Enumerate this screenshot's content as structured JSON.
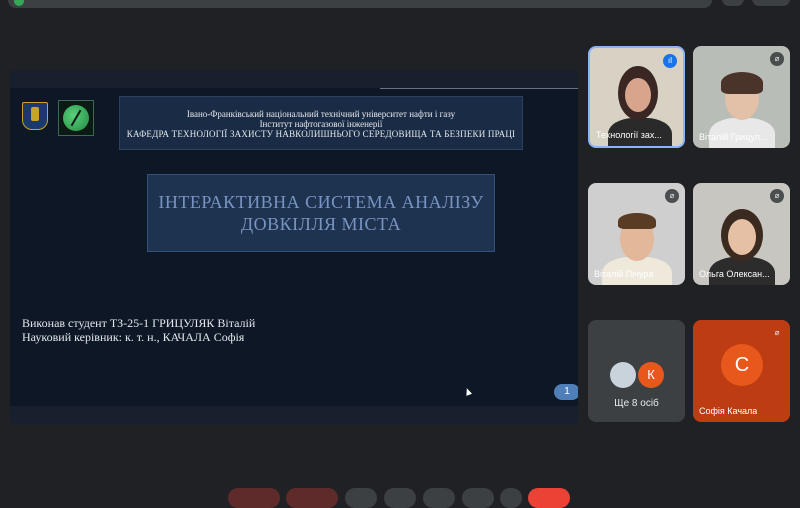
{
  "top": {
    "text": ""
  },
  "slide": {
    "header_line1": "Івано-Франківський національний технічний університет нафти і газу",
    "header_line2": "Інститут нафтогазової інженерії",
    "header_line3": "КАФЕДРА ТЕХНОЛОГІЇ ЗАХИСТУ НАВКОЛИШНЬОГО СЕРЕДОВИЩА ТА БЕЗПЕКИ ПРАЦІ",
    "title_line1": "ІНТЕРАКТИВНА СИСТЕМА АНАЛІЗУ",
    "title_line2": "ДОВКІЛЛЯ МІСТА",
    "author_line1": "Виконав студент ТЗ-25-1 ГРИЦУЛЯК Віталій",
    "author_line2": "Науковий керівник: к. т. н., КАЧАЛА Софія",
    "page_number": "1"
  },
  "participants": [
    {
      "name": "Технології зах...",
      "speaking": true
    },
    {
      "name": "Віталій Грицул...",
      "muted": true
    },
    {
      "name": "Віталій Пічура",
      "muted": true
    },
    {
      "name": "Ольга Олексан...",
      "muted": true
    }
  ],
  "more": {
    "label": "Ще 8 осіб",
    "avatar_letter": "К"
  },
  "sofia": {
    "name": "Софія Качала",
    "avatar_letter": "С"
  },
  "bottom": {
    "time": ""
  },
  "colors": {
    "accent": "#1a73e8",
    "end_call": "#ea4335",
    "avatar_orange": "#e8571b"
  },
  "icons": {
    "mic_muted": "mic-off-icon",
    "speaking": "audio-wave-icon"
  }
}
